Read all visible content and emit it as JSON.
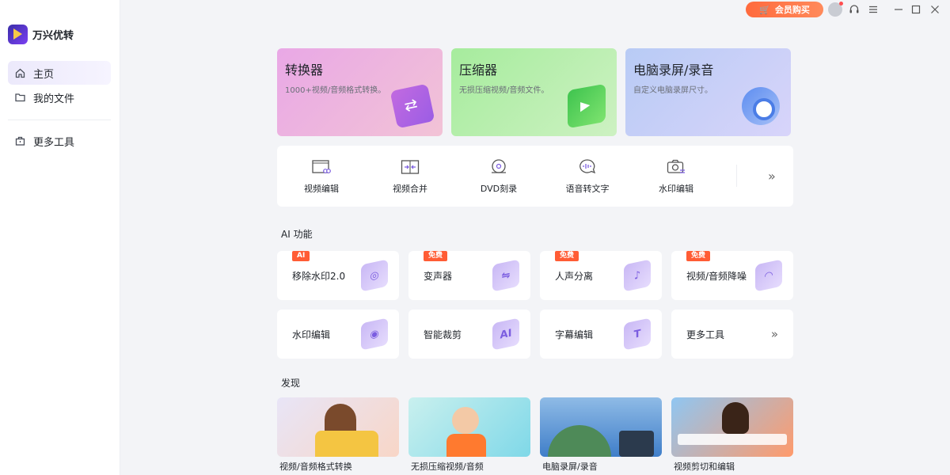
{
  "app": {
    "name": "万兴优转"
  },
  "titlebar": {
    "vip_label": "会员购买"
  },
  "sidebar": {
    "items": [
      {
        "label": "主页",
        "icon": "home-icon"
      },
      {
        "label": "我的文件",
        "icon": "folder-icon"
      }
    ],
    "more_tools": {
      "label": "更多工具",
      "icon": "toolbox-icon"
    }
  },
  "top_cards": [
    {
      "title": "转换器",
      "subtitle": "1000+视频/音频格式转换。"
    },
    {
      "title": "压缩器",
      "subtitle": "无损压缩视频/音频文件。"
    },
    {
      "title": "电脑录屏/录音",
      "subtitle": "自定义电脑录屏尺寸。"
    }
  ],
  "tools": [
    {
      "label": "视频编辑",
      "icon": "video-edit-icon"
    },
    {
      "label": "视频合并",
      "icon": "merge-icon"
    },
    {
      "label": "DVD刻录",
      "icon": "dvd-icon"
    },
    {
      "label": "语音转文字",
      "icon": "speech-to-text-icon"
    },
    {
      "label": "水印编辑",
      "icon": "watermark-icon"
    }
  ],
  "ai_section": {
    "title": "AI 功能",
    "cards": [
      {
        "label": "移除水印2.0",
        "badge": "AI",
        "glyph": "◎"
      },
      {
        "label": "变声器",
        "badge": "免费",
        "glyph": "⇋"
      },
      {
        "label": "人声分离",
        "badge": "免费",
        "glyph": "♪"
      },
      {
        "label": "视频/音频降噪",
        "badge": "免费",
        "glyph": "◠"
      },
      {
        "label": "水印编辑",
        "badge": "",
        "glyph": "◉"
      },
      {
        "label": "智能裁剪",
        "badge": "",
        "glyph": "AI"
      },
      {
        "label": "字幕编辑",
        "badge": "",
        "glyph": "T"
      },
      {
        "label": "更多工具",
        "badge": "",
        "glyph": ""
      }
    ]
  },
  "discover": {
    "title": "发现",
    "items": [
      {
        "label": "视频/音频格式转换"
      },
      {
        "label": "无损压缩视频/音频"
      },
      {
        "label": "电脑录屏/录音"
      },
      {
        "label": "视频剪切和编辑"
      }
    ]
  },
  "colors": {
    "accent": "#ff5c35",
    "vip": "#ff6a3d",
    "sidebar_active": "#ece9fb"
  }
}
